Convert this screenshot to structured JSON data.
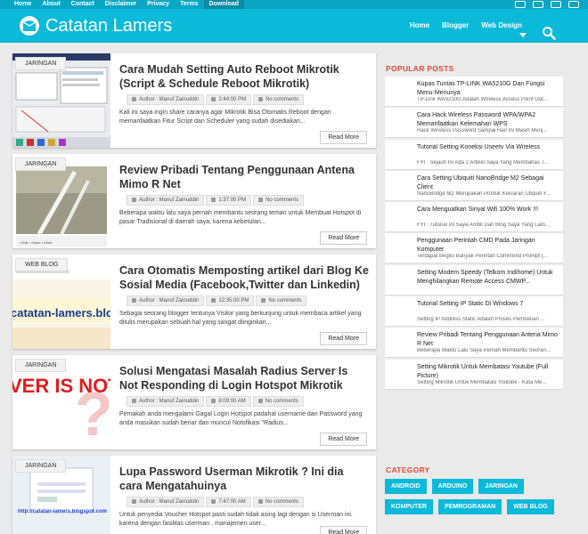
{
  "topnav": [
    "Home",
    "About",
    "Contact",
    "Disclaimer",
    "Privacy",
    "Terms",
    "Download"
  ],
  "brand": "Catatan Lamers",
  "mainnav": [
    "Home",
    "Blogger",
    "Web Design"
  ],
  "posts": [
    {
      "category": "JARINGAN",
      "title": "Cara Mudah Setting Auto Reboot Mikrotik (Script & Schedule Reboot Mikrotik)",
      "author": "Author : Manuf Zainuddin",
      "time": "2:44:00 PM",
      "comments": "No comments",
      "excerpt": "Kali ini saya ingin share caranya agar Mikrotik Bisa Otomatis Reboot dengan memanfaatkan Fitur Script dan Scheduler yang sudah disediakan...",
      "readmore": "Read More"
    },
    {
      "category": "JARINGAN",
      "title": "Review Pribadi Tentang Penggunaan Antena Mimo R Net",
      "author": "Author : Manuf Zainuddin",
      "time": "1:37:00 PM",
      "comments": "No comments",
      "excerpt": "Beberapa waktu lalu saya pernah membantu seorang teman untuk Membuat Hotspot di pasar Tradisional di daerah saya, karena kebetulan...",
      "readmore": "Read More"
    },
    {
      "category": "WEB BLOG",
      "title": "Cara Otomatis Memposting artikel dari Blog Ke Sosial Media (Facebook,Twitter dan Linkedin)",
      "author": "Author : Manuf Zainuddin",
      "time": "12:35:00 PM",
      "comments": "No comments",
      "excerpt": "Sebagai seorang blogger tentunya Visitor yang berkunjung untuk membaca artikel yang ditulis merupakan sebuah hal yang sangat diinginkan...",
      "readmore": "Read More",
      "thumb_text": "catatan-lamers.blogspot"
    },
    {
      "category": "JARINGAN",
      "title": "Solusi Mengatasi Masalah Radius Server Is Not Responding di Login Hotspot Mikrotik",
      "author": "Author : Manuf Zainuddin",
      "time": "8:09:00 AM",
      "comments": "No comments",
      "excerpt": "Pemakah anda mengalami Gagal Login Hotspot padahal username dan Password yang anda masukan sudah benar dan muncul Notofikasi \"Radius...",
      "readmore": "Read More",
      "thumb_text": "VER IS NOT"
    },
    {
      "category": "JARINGAN",
      "title": "Lupa Password Userman Mikrotik ? Ini dia cara Mengatahuinya",
      "author": "Author : Manuf Zainuddin",
      "time": "7:47:00 AM",
      "comments": "No comments",
      "excerpt": "Untuk penyedia Voucher Hotspot pasti sudah tidak asing lagi dengan si Userman ini. karena dengan fasilitas userman , manajemen user...",
      "readmore": "Read More",
      "thumb_text": "http://catatan-lamers.blogspot.com"
    }
  ],
  "sidebar": {
    "popular_title": "POPULAR POSTS",
    "popular": [
      {
        "title": "Kupas Tuntas TP-LINK WA5210G Dan Fungsi Menu-Menunya",
        "excerpt": "TP-Link WA5210G Adalah Wireless Access Point Out..."
      },
      {
        "title": "Cara Hack Wireless Password WPA/WPA2 Memanfaatkan Kelemahan WPS",
        "excerpt": "Hack Wireless Password Sampai Hari Ini Masih Menj..."
      },
      {
        "title": "Tutorial Setting Koneksi Useetv Via Wireless",
        "excerpt": "FYI : Sejauh Ini Ada 2 Artikel Saya Yang Membahas T..."
      },
      {
        "title": "Cara Setting Ubiquiti NanoBridge M2 Sebagai Client",
        "excerpt": "NanoBridge M2 Merupakan Produk Keluaran Ubquiti Y..."
      },
      {
        "title": "Cara Menguatkan Sinyal Wifi 100% Work !!!",
        "excerpt": "FYI : Tutorial Ini Saya Ambil Dari Blog Saya Yang Lam..."
      },
      {
        "title": "Penggunaan Perintah CMD Pada Jaringan Komputer",
        "excerpt": "Terdapat Begitu Banyak  Perintah Commond Prompt (..."
      },
      {
        "title": "Setting Modem Speedy (Telkom Indihome) Untuk Menghilangkan Remote Access CMWP...",
        "excerpt": ""
      },
      {
        "title": "Tutorial Setting IP Static Di Windows 7",
        "excerpt": "Setting IP Address Static   Adalah Proses Pemberian ..."
      },
      {
        "title": "Review Pribadi Tentang Penggunaan Antena Mimo R Net",
        "excerpt": "Beberapa Waktu Lalu Saya Pernah Membantu Seoran..."
      },
      {
        "title": "Setting Mikrotik Untuk Membatasi Youtube (Full Picture)",
        "excerpt": "Setting Mikrotik Untuk Membatasi Youtube - Kata Me..."
      }
    ],
    "category_title": "CATEGORY",
    "categories": [
      "ANDROID",
      "ARDUINO",
      "JARINGAN",
      "KOMPUTER",
      "PEMROGRAMAN",
      "WEB BLOG"
    ]
  },
  "colors": {
    "accent": "#0bbad9",
    "topbar": "#0aa6c4",
    "section_title": "#e04b3a"
  }
}
